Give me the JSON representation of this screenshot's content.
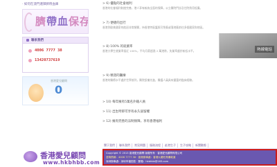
{
  "sidebar": {
    "link": "· 如何在澳門選擇臍帶血庫",
    "banner": {
      "prefix": "臍",
      "mid": "帶血",
      "suffix": "保存"
    },
    "contact": {
      "title": "聯系我們",
      "phones": [
        "4006 7777 38",
        "13420737619"
      ]
    },
    "promo": {
      "tag": "香港愛兒顧問",
      "zero": "0"
    }
  },
  "content": {
    "items": [
      {
        "title": "> 6) 優點的社會福利",
        "body": "香港的社會福利制度完善，港人享有較為全面的保障，公立醫院門診及住院費用低廉。"
      },
      {
        "title": "> 7) 便捷的出行",
        "body": "香港到歐美國家的航班非常頻繁，持香港特區護照可免簽或落地簽前往多個國家和地區。"
      },
      {
        "title": "> 8) 100% 的就業率",
        "body": "香港大學生就業率接近 100%，平均月薪超過 2 萬港幣，失業率處於較低水平。"
      },
      {
        "title": "> 9) 精湛的醫療",
        "body": "香港的醫療水平處於世界前列，醫院設備先進，醫護人員具有豐富的臨床經驗。"
      },
      {
        "title": "> 10) 每年擁有5萬名外籍人員",
        "body": ""
      },
      {
        "title": "> 11) 出生時即可享有永久居留權",
        "body": ""
      },
      {
        "title": "> 12) 擁有完善的法制保障，享有香港福利",
        "body": ""
      }
    ]
  },
  "photo": {
    "label": "熱線電話"
  },
  "footer": {
    "nav": [
      "關于我們",
      "聯系我們",
      "常見問題",
      "服務流程",
      "赴港生子",
      "生子攻略",
      "新聞動態"
    ],
    "logo_cn": "香港愛兒顧問",
    "url": "www.hkbhbb.com",
    "info": [
      "Copyright © 2013 香港愛兒顧問 版權所有 ‧ 香港愛兒顧問有限公司",
      "咨詢熱線：4006 7777 38 ‧ 香港辦事處：香港九龍旺角彌敦道",
      "深圳辦事處：深圳市福田區 ‧ 郵箱：hkbhbb@163.com"
    ]
  },
  "colors": {
    "accent": "#7a49b3",
    "footer_bg": "#6a58b0",
    "highlight_border": "#cc1a1a"
  }
}
